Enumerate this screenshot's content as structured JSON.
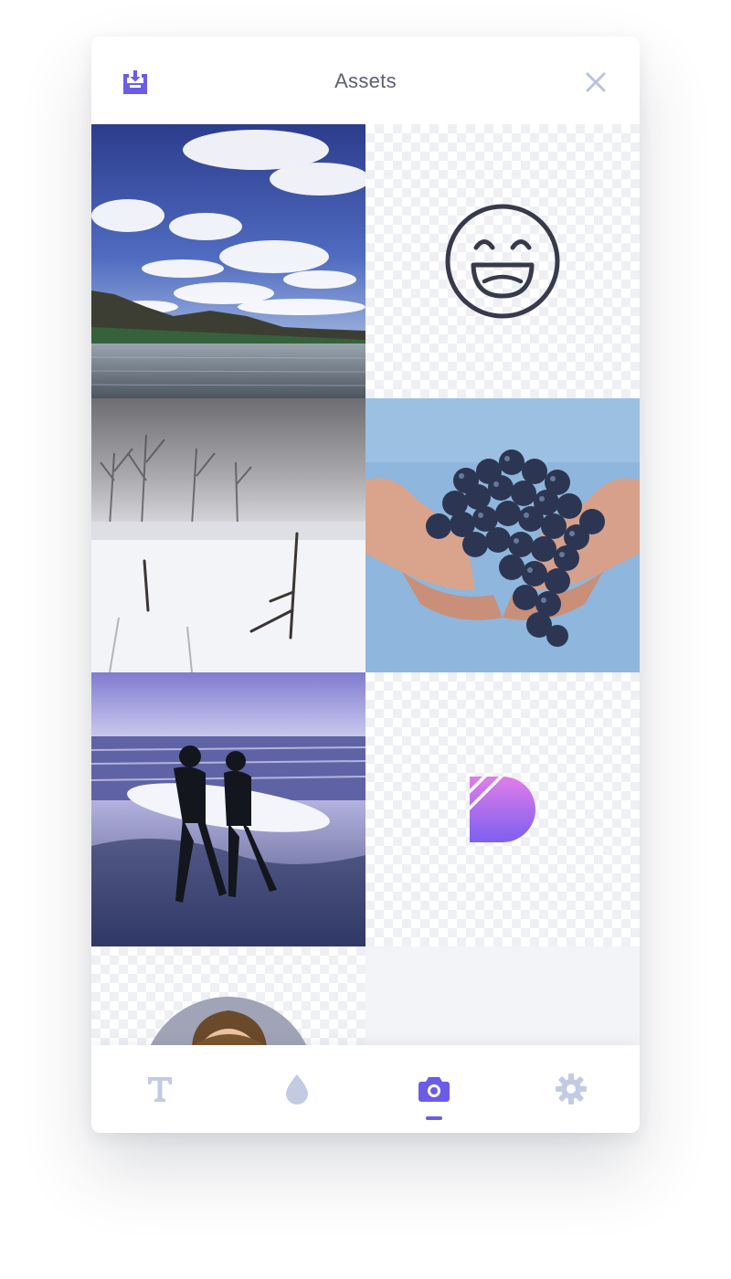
{
  "header": {
    "title": "Assets",
    "left_icon": "download-tray-icon",
    "right_icon": "close-icon"
  },
  "assets": [
    {
      "kind": "photo",
      "subject": "lake-sky"
    },
    {
      "kind": "icon",
      "subject": "smiley-face"
    },
    {
      "kind": "photo",
      "subject": "snowy-field"
    },
    {
      "kind": "photo",
      "subject": "grapes-in-hands"
    },
    {
      "kind": "photo",
      "subject": "surfers-on-beach"
    },
    {
      "kind": "logo",
      "subject": "p-logo"
    },
    {
      "kind": "avatar",
      "subject": "person-portrait"
    }
  ],
  "tabs": [
    {
      "icon": "text-icon",
      "active": false
    },
    {
      "icon": "droplet-icon",
      "active": false
    },
    {
      "icon": "camera-icon",
      "active": true
    },
    {
      "icon": "gear-icon",
      "active": false
    }
  ],
  "colors": {
    "accent": "#6b5ce7",
    "inactive_icon": "#c3cbe3",
    "title_text": "#5b5f6f",
    "grid_background": "#f3f4f8"
  }
}
